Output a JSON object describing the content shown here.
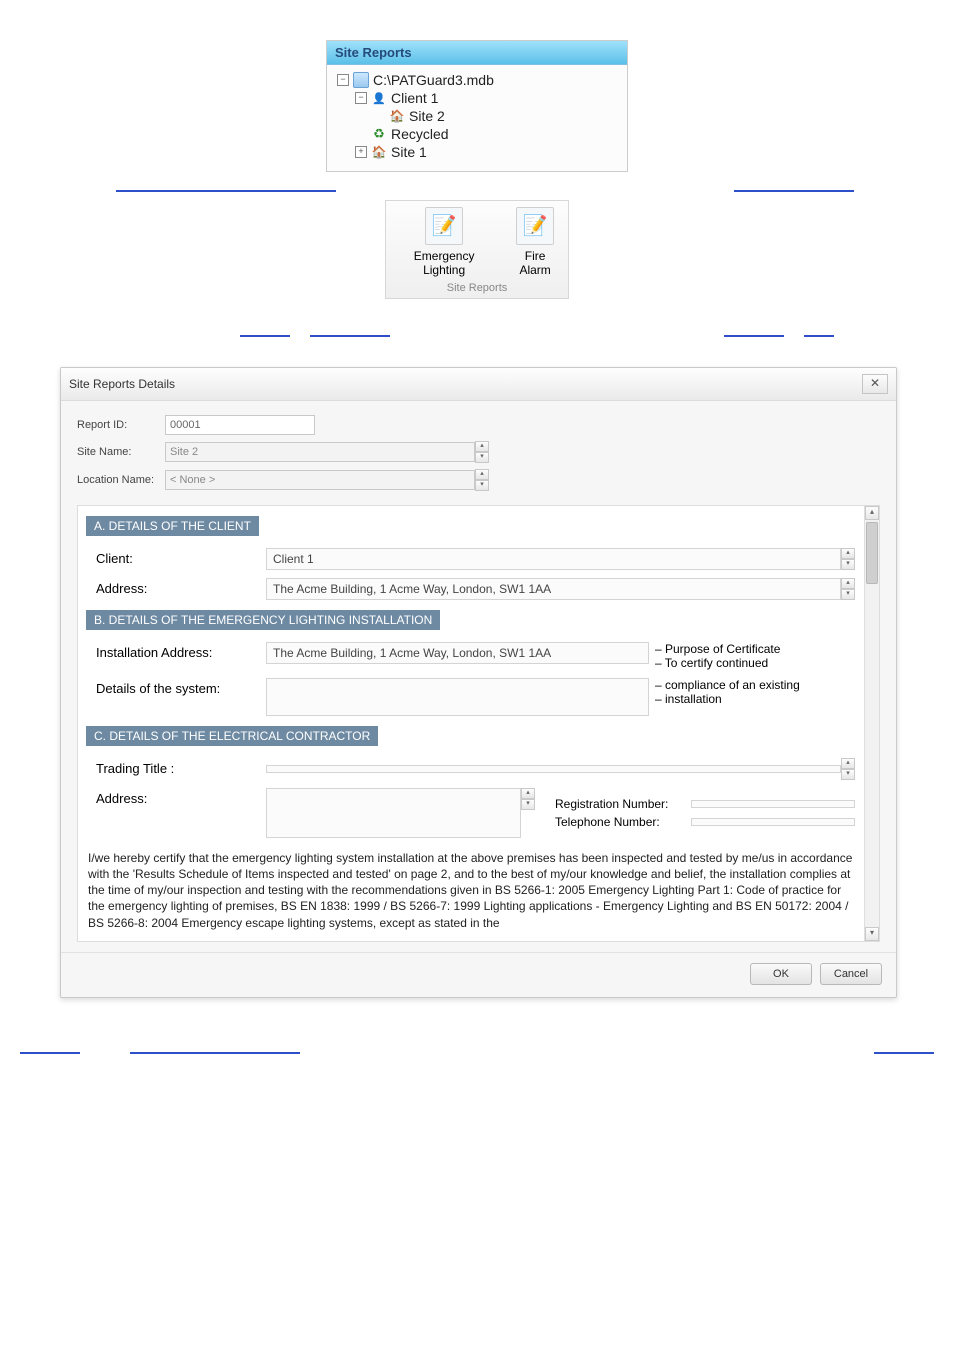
{
  "tree": {
    "header": "Site Reports",
    "nodes": {
      "db": "C:\\PATGuard3.mdb",
      "client1": "Client 1",
      "site2": "Site 2",
      "recycled": "Recycled",
      "site1": "Site 1"
    }
  },
  "ribbon": {
    "items": [
      {
        "label": "Emergency Lighting"
      },
      {
        "label": "Fire Alarm"
      }
    ],
    "caption": "Site Reports"
  },
  "dialog": {
    "title": "Site Reports Details",
    "meta": {
      "report_id_label": "Report ID:",
      "report_id_value": "00001",
      "site_name_label": "Site Name:",
      "site_name_value": "Site 2",
      "location_name_label": "Location Name:",
      "location_name_value": "< None >"
    },
    "sections": {
      "a_title": "A. DETAILS OF THE CLIENT",
      "a_client_label": "Client:",
      "a_client_value": "Client 1",
      "a_address_label": "Address:",
      "a_address_value": "The Acme Building, 1 Acme Way, London, SW1 1AA",
      "b_title": "B. DETAILS OF THE EMERGENCY LIGHTING INSTALLATION",
      "b_install_addr_label": "Installation Address:",
      "b_install_addr_value": "The Acme Building, 1 Acme Way, London, SW1 1AA",
      "b_details_label": "Details of the system:",
      "b_details_value": "",
      "b_side": {
        "l1": "– Purpose of Certificate",
        "l2": "– To certify continued",
        "l3": "– compliance of an existing",
        "l4": "– installation"
      },
      "c_title": "C. DETAILS OF THE ELECTRICAL CONTRACTOR",
      "c_trading_title_label": "Trading Title :",
      "c_trading_title_value": "",
      "c_address_label": "Address:",
      "c_address_value": "",
      "c_regnum_label": "Registration Number:",
      "c_regnum_value": "",
      "c_tel_label": "Telephone Number:",
      "c_tel_value": ""
    },
    "declaration": "I/we hereby certify that the emergency lighting system installation at the above premises has been inspected and tested by me/us in accordance with the 'Results Schedule of Items inspected and tested' on page 2, and to the best of my/our knowledge and belief, the installation complies at the time of my/our inspection and testing with the recommendations given in BS 5266-1: 2005 Emergency Lighting Part 1: Code of practice for the emergency lighting of premises, BS EN 1838: 1999 / BS 5266-7: 1999 Lighting applications - Emergency Lighting and BS EN 50172: 2004 / BS 5266-8: 2004 Emergency escape lighting systems, except as stated in the",
    "buttons": {
      "ok": "OK",
      "cancel": "Cancel"
    }
  }
}
